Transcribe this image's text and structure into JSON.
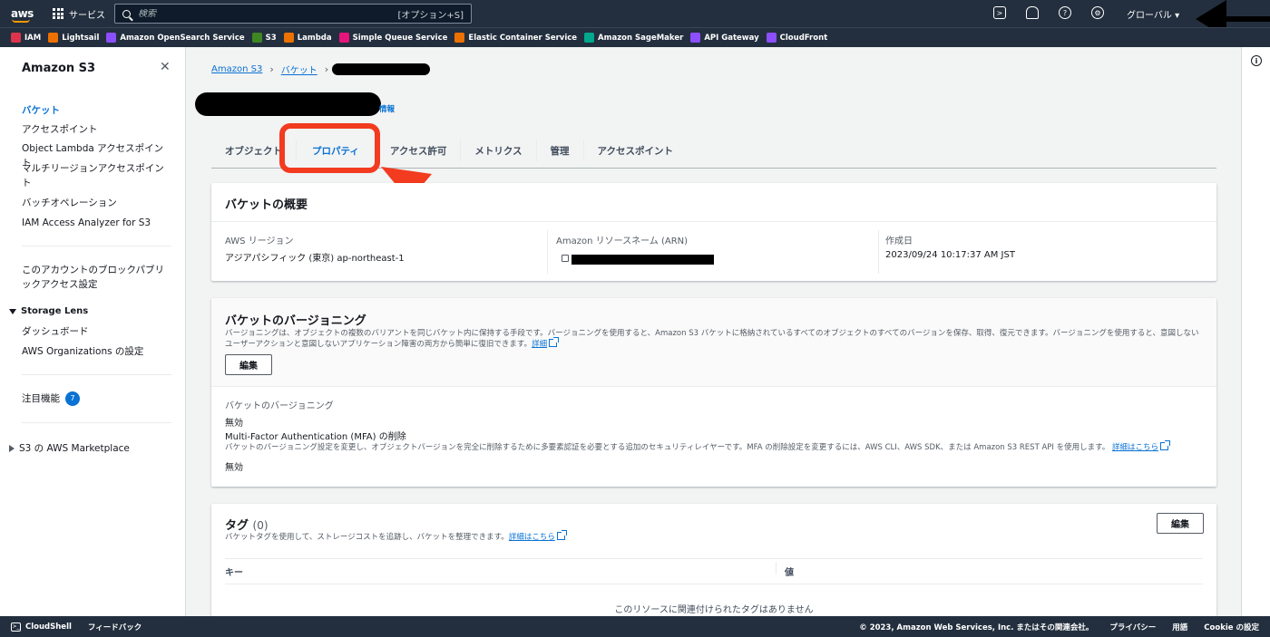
{
  "topnav": {
    "logo": "aws",
    "services_label": "サービス",
    "search_placeholder": "検索",
    "search_shortcut": "[オプション+S]",
    "region": "グローバル ▾"
  },
  "favorites": [
    {
      "label": "IAM",
      "color": "#dd344c"
    },
    {
      "label": "Lightsail",
      "color": "#ed7100"
    },
    {
      "label": "Amazon OpenSearch Service",
      "color": "#8c4fff"
    },
    {
      "label": "S3",
      "color": "#3f8624"
    },
    {
      "label": "Lambda",
      "color": "#ed7100"
    },
    {
      "label": "Simple Queue Service",
      "color": "#e7157b"
    },
    {
      "label": "Elastic Container Service",
      "color": "#ed7100"
    },
    {
      "label": "Amazon SageMaker",
      "color": "#01a88d"
    },
    {
      "label": "API Gateway",
      "color": "#8c4fff"
    },
    {
      "label": "CloudFront",
      "color": "#8c4fff"
    }
  ],
  "sidebar": {
    "title": "Amazon S3",
    "items": [
      {
        "label": "バケット"
      },
      {
        "label": "アクセスポイント"
      },
      {
        "label": "Object Lambda アクセスポイント"
      },
      {
        "label": "マルチリージョンアクセスポイント"
      },
      {
        "label": "バッチオペレーション"
      },
      {
        "label": "IAM Access Analyzer for S3"
      }
    ],
    "block_public": "このアカウントのブロックパブリックアクセス設定",
    "storage_lens": "Storage Lens",
    "storage_lens_items": [
      "ダッシュボード",
      "AWS Organizations の設定"
    ],
    "featured": "注目機能",
    "featured_count": "7",
    "marketplace": "S3 の AWS Marketplace"
  },
  "breadcrumb": {
    "root": "Amazon S3",
    "buckets": "バケット"
  },
  "info_link": "情報",
  "tabs": [
    "オブジェクト",
    "プロパティ",
    "アクセス許可",
    "メトリクス",
    "管理",
    "アクセスポイント"
  ],
  "overview": {
    "title": "バケットの概要",
    "region_label": "AWS リージョン",
    "region_value": "アジアパシフィック (東京) ap-northeast-1",
    "arn_label": "Amazon リソースネーム (ARN)",
    "created_label": "作成日",
    "created_value": "2023/09/24 10:17:37 AM JST"
  },
  "versioning": {
    "title": "バケットのバージョニング",
    "desc": "バージョニングは、オブジェクトの複数のバリアントを同じバケット内に保持する手段です。バージョニングを使用すると、Amazon S3 バケットに格納されているすべてのオブジェクトのすべてのバージョンを保存、取得、復元できます。バージョニングを使用すると、意図しないユーザーアクションと意図しないアプリケーション障害の両方から簡単に復旧できます。",
    "desc_link": "詳細",
    "edit_label": "編集",
    "status_label": "バケットのバージョニング",
    "status_value": "無効",
    "mfa_label": "Multi-Factor Authentication (MFA) の削除",
    "mfa_desc": "バケットのバージョニング設定を変更し、オブジェクトバージョンを完全に削除するために多要素認証を必要とする追加のセキュリティレイヤーです。MFA の削除設定を変更するには、AWS CLI、AWS SDK、または Amazon S3 REST API を使用します。",
    "mfa_link": "詳細はこちら",
    "mfa_value": "無効"
  },
  "tags": {
    "title": "タグ",
    "count": "(0)",
    "desc": "バケットタグを使用して、ストレージコストを追跡し、バケットを整理できます。",
    "desc_link": "詳細はこちら",
    "edit_label": "編集",
    "col_key": "キー",
    "col_value": "値",
    "empty": "このリソースに関連付けられたタグはありません"
  },
  "footer": {
    "cloudshell": "CloudShell",
    "feedback": "フィードバック",
    "copyright": "© 2023, Amazon Web Services, Inc. またはその関連会社。",
    "privacy": "プライバシー",
    "terms": "用語",
    "cookie": "Cookie の設定"
  }
}
